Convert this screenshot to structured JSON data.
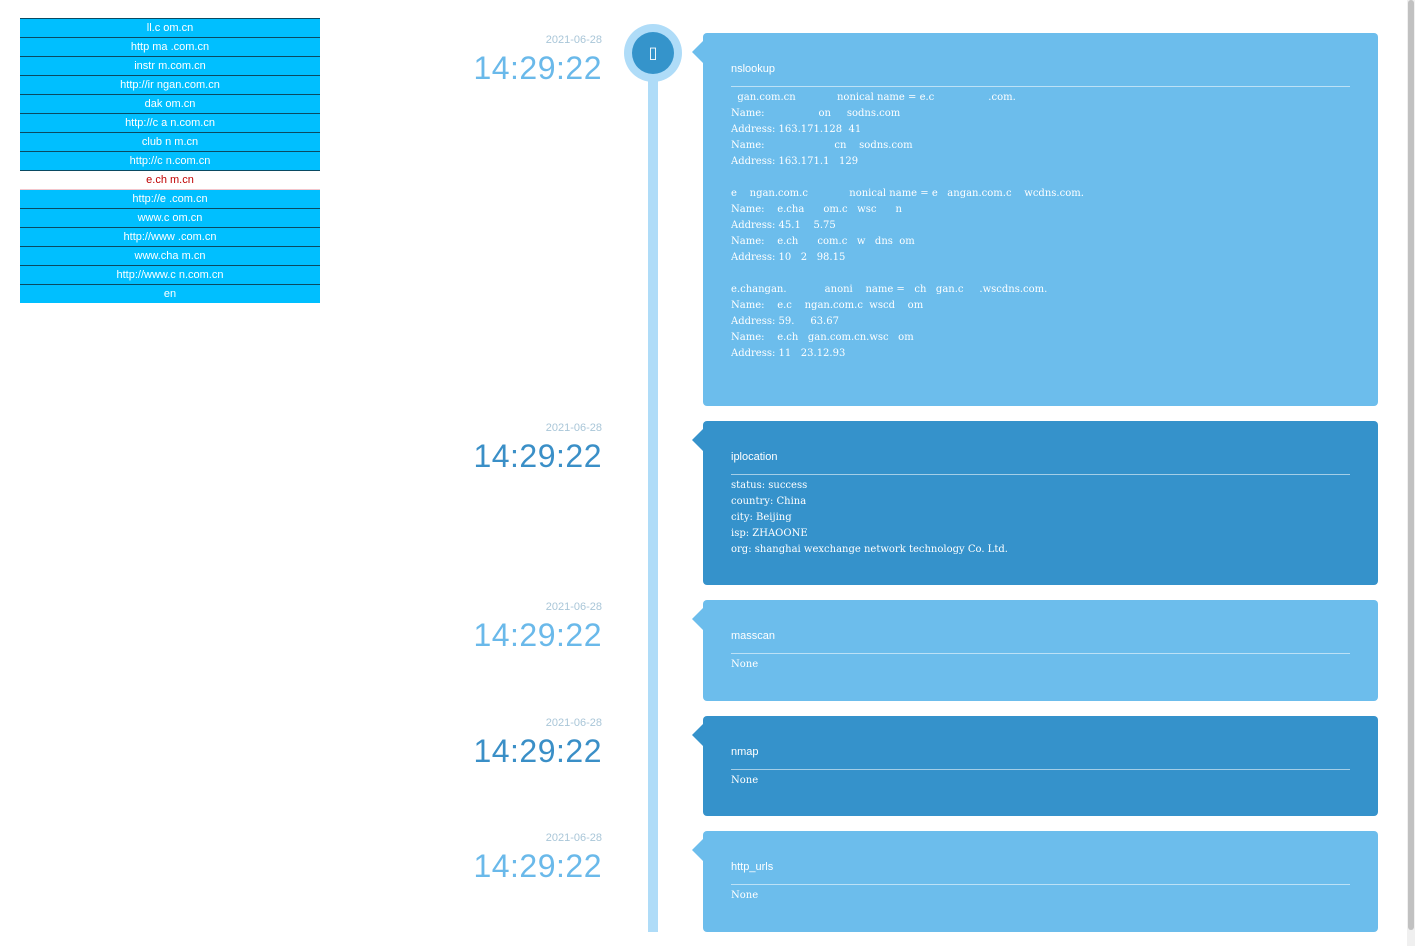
{
  "domains": [
    "ll.c     om.cn",
    "http   ma       .com.cn",
    "instr              m.com.cn",
    "http://ir              ngan.com.cn",
    "dak              om.cn",
    "http://c          a   n.com.cn",
    "club          n  m.cn",
    "http://c          n.com.cn",
    "e.ch       m.cn",
    "http://e          .com.cn",
    "www.c           om.cn",
    "http://www           .com.cn",
    "www.cha         m.cn",
    "http://www.c       n.com.cn",
    "en"
  ],
  "active_index": 8,
  "timeline_icon": "▯",
  "entries": [
    {
      "date": "2021-06-28",
      "time": "14:29:22",
      "title": "nslookup",
      "body": "  gan.com.cn             nonical name = e.c                 .com.\nName:                 on     sodns.com\nAddress: 163.171.128  41\nName:                      cn    sodns.com\nAddress: 163.171.1   129\n\ne    ngan.com.c             nonical name = e   angan.com.c    wcdns.com.\nName:    e.cha      om.c   wsc      n\nAddress: 45.1    5.75\nName:    e.ch      com.c   w   dns  om\nAddress: 10   2   98.15\n\ne.changan.            anoni    name =   ch   gan.c     .wscdns.com.\nName:    e.c    ngan.com.c  wscd    om\nAddress: 59.     63.67\nName:    e.ch   gan.com.cn.wsc   om\nAddress: 11   23.12.93"
    },
    {
      "date": "2021-06-28",
      "time": "14:29:22",
      "title": "iplocation",
      "body": "status: success\ncountry: China\ncity: Beijing\nisp: ZHAOONE\norg: shanghai wexchange network technology Co. Ltd."
    },
    {
      "date": "2021-06-28",
      "time": "14:29:22",
      "title": "masscan",
      "body": "None"
    },
    {
      "date": "2021-06-28",
      "time": "14:29:22",
      "title": "nmap",
      "body": "None"
    },
    {
      "date": "2021-06-28",
      "time": "14:29:22",
      "title": "http_urls",
      "body": "None"
    }
  ]
}
